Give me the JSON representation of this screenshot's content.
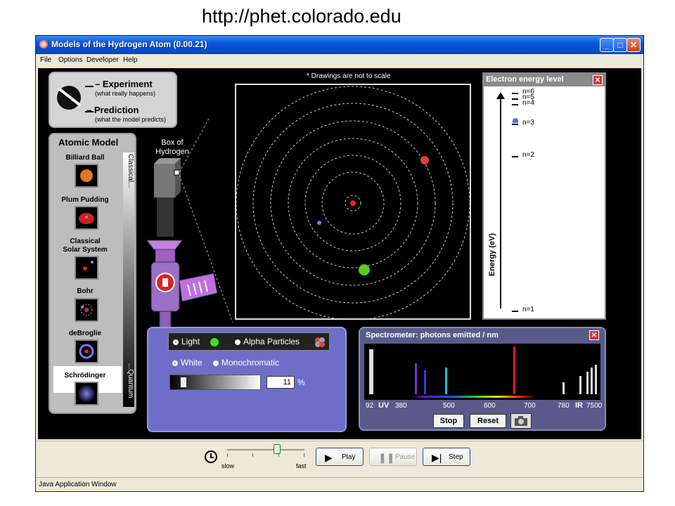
{
  "url_caption": "http://phet.colorado.edu",
  "window": {
    "title": "Models of the Hydrogen Atom (0.00.21)",
    "minimize": "_",
    "maximize": "□",
    "close": "✕"
  },
  "menu": [
    "File",
    "Options",
    "Developer",
    "Help"
  ],
  "mode": {
    "experiment": "– Experiment",
    "experiment_sub": "(what really happens)",
    "prediction": "– Prediction",
    "prediction_sub": "(what the model predicts)"
  },
  "atomic_model": {
    "title": "Atomic Model",
    "items": [
      "Billiard Ball",
      "Plum Pudding",
      "Classical Solar System",
      "Bohr",
      "deBroglie",
      "Schrödinger"
    ],
    "selected": "Bohr",
    "scale_top": "Classical...",
    "scale_bottom": "...Quantum"
  },
  "box_label": "Box of Hydrogen",
  "drawings_note": "* Drawings are not to scale",
  "energy": {
    "title": "Electron energy level",
    "close": "✕",
    "levels": [
      "n=6",
      "n=5",
      "n=4",
      "n=3",
      "n=2",
      "n=1"
    ],
    "current_level": "n=3",
    "axis_label": "Energy (eV)"
  },
  "gun": {
    "light": "Light",
    "alpha": "Alpha Particles",
    "white": "White",
    "monochromatic": "Monochromatic",
    "selected_source": "Light",
    "selected_type": "White",
    "intensity": "11",
    "intensity_unit": "%"
  },
  "spectrometer": {
    "title": "Spectrometer: photons emitted / nm",
    "close": "✕",
    "ticks": [
      "92",
      "380",
      "500",
      "600",
      "700",
      "780",
      "7500"
    ],
    "uv": "UV",
    "ir": "IR",
    "stop": "Stop",
    "reset": "Reset"
  },
  "clock": {
    "slow": "slow",
    "fast": "fast",
    "speed_fraction": 0.65,
    "play": "Play",
    "pause": "Pause",
    "step": "Step"
  },
  "status": "Java Application Window",
  "colors": {
    "titlebar": "#0a58d8",
    "canvas": "#000000",
    "gun_panel": "#6e6ec8",
    "spectrometer": "#5a5a8a"
  }
}
